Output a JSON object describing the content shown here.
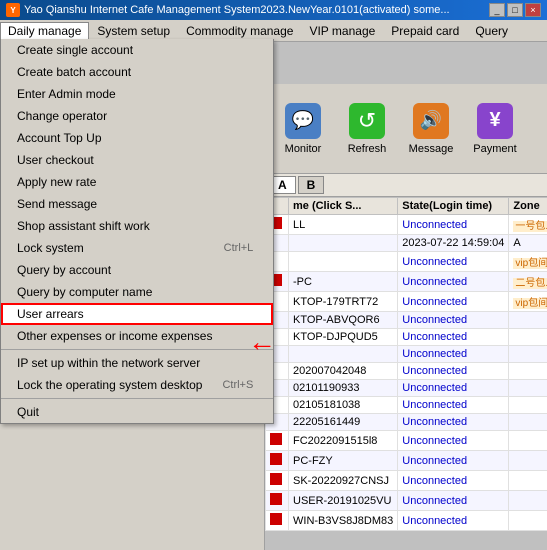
{
  "titlebar": {
    "title": "Yao Qianshu Internet Cafe Management System2023.NewYear.0101(activated)  some...",
    "icon": "Y"
  },
  "menubar": {
    "items": [
      {
        "id": "daily",
        "label": "Daily manage"
      },
      {
        "id": "system",
        "label": "System setup"
      },
      {
        "id": "commodity",
        "label": "Commodity manage"
      },
      {
        "id": "vip",
        "label": "VIP manage"
      },
      {
        "id": "prepaid",
        "label": "Prepaid card"
      },
      {
        "id": "query",
        "label": "Query"
      }
    ]
  },
  "dropdown": {
    "items": [
      {
        "id": "create-single",
        "label": "Create single account",
        "shortcut": ""
      },
      {
        "id": "create-batch",
        "label": "Create batch account",
        "shortcut": ""
      },
      {
        "id": "enter-admin",
        "label": "Enter Admin mode",
        "shortcut": ""
      },
      {
        "id": "change-operator",
        "label": "Change operator",
        "shortcut": ""
      },
      {
        "id": "account-topup",
        "label": "Account Top Up",
        "shortcut": ""
      },
      {
        "id": "user-checkout",
        "label": "User checkout",
        "shortcut": ""
      },
      {
        "id": "apply-rate",
        "label": "Apply new rate",
        "shortcut": ""
      },
      {
        "id": "send-message",
        "label": "Send message",
        "shortcut": ""
      },
      {
        "id": "shop-assistant",
        "label": "Shop assistant shift work",
        "shortcut": ""
      },
      {
        "id": "lock-system",
        "label": "Lock system",
        "shortcut": "Ctrl+L"
      },
      {
        "id": "query-account",
        "label": "Query by account",
        "shortcut": ""
      },
      {
        "id": "query-computer",
        "label": "Query by computer name",
        "shortcut": ""
      },
      {
        "id": "user-arrears",
        "label": "User arrears",
        "shortcut": ""
      },
      {
        "id": "other-expenses",
        "label": "Other expenses or income expenses",
        "shortcut": ""
      },
      {
        "id": "ip-setup",
        "label": "IP set up within the network server",
        "shortcut": ""
      },
      {
        "id": "lock-desktop",
        "label": "Lock the operating system desktop",
        "shortcut": "Ctrl+S"
      },
      {
        "id": "quit",
        "label": "Quit",
        "shortcut": ""
      }
    ]
  },
  "toolbar": {
    "buttons": [
      {
        "id": "monitor",
        "label": "Monitor",
        "icon": "💬",
        "color": "icon-monitor"
      },
      {
        "id": "refresh",
        "label": "Refresh",
        "icon": "↺",
        "color": "icon-refresh"
      },
      {
        "id": "message",
        "label": "Message",
        "icon": "🔊",
        "color": "icon-message"
      },
      {
        "id": "payment",
        "label": "Payment",
        "icon": "¥",
        "color": "icon-payment"
      }
    ]
  },
  "tabs": {
    "a_label": "A",
    "b_label": "B"
  },
  "table": {
    "headers": [
      "",
      "me (Click S...",
      "State(Login time)",
      "Zone"
    ],
    "rows": [
      {
        "indicator": true,
        "name": "LL",
        "state": "Unconnected",
        "login_time": "",
        "zone": "一号包..."
      },
      {
        "indicator": false,
        "name": "",
        "state": "2023-07-22 14:59:04",
        "login_time": "A",
        "zone": ""
      },
      {
        "indicator": false,
        "name": "",
        "state": "Unconnected",
        "login_time": "",
        "zone": "vip包间"
      },
      {
        "indicator": true,
        "name": "-PC",
        "state": "Unconnected",
        "login_time": "",
        "zone": "二号包..."
      },
      {
        "indicator": false,
        "name": "KTOP-179TRT72",
        "state": "Unconnected",
        "login_time": "",
        "zone": "vip包间"
      },
      {
        "indicator": false,
        "name": "KTOP-ABVQOR6",
        "state": "Unconnected",
        "login_time": "",
        "zone": ""
      },
      {
        "indicator": false,
        "name": "KTOP-DJPQUD5",
        "state": "Unconnected",
        "login_time": "",
        "zone": ""
      },
      {
        "indicator": false,
        "name": "",
        "state": "Unconnected",
        "login_time": "",
        "zone": ""
      },
      {
        "indicator": false,
        "name": "202007042048",
        "state": "Unconnected",
        "login_time": "",
        "zone": ""
      },
      {
        "indicator": false,
        "name": "02101190933",
        "state": "Unconnected",
        "login_time": "",
        "zone": ""
      },
      {
        "indicator": false,
        "name": "02105181038",
        "state": "Unconnected",
        "login_time": "",
        "zone": ""
      },
      {
        "indicator": false,
        "name": "22205161449",
        "state": "Unconnected",
        "login_time": "",
        "zone": ""
      },
      {
        "indicator": true,
        "name": "FC2022091515l8",
        "state": "Unconnected",
        "login_time": "",
        "zone": ""
      },
      {
        "indicator": true,
        "name": "PC-FZY",
        "state": "Unconnected",
        "login_time": "",
        "zone": ""
      },
      {
        "indicator": true,
        "name": "SK-20220927CNSJ",
        "state": "Unconnected",
        "login_time": "",
        "zone": ""
      },
      {
        "indicator": true,
        "name": "USER-20191025VU",
        "state": "Unconnected",
        "login_time": "",
        "zone": ""
      },
      {
        "indicator": true,
        "name": "WIN-B3VS8J8DM83",
        "state": "Unconnected",
        "login_time": "",
        "zone": ""
      }
    ]
  },
  "arrow": {
    "symbol": "←"
  },
  "colors": {
    "accent_blue": "#0000cc",
    "highlight_red": "#cc0000",
    "menu_active": "#316ac5",
    "title_bg": "#1b6fd6"
  }
}
